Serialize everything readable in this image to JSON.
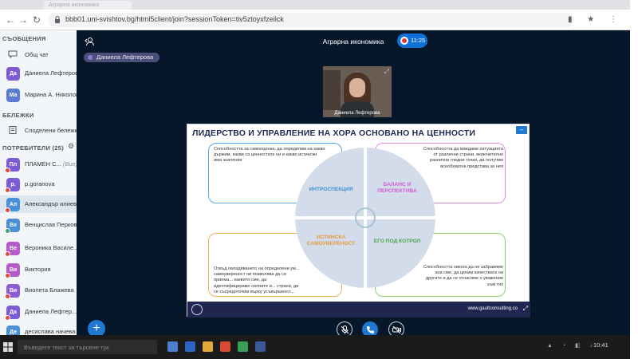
{
  "browser": {
    "tab_title": "Аграрна икономика",
    "url": "bbb01.uni-svishtov.bg/html5client/join?sessionToken=tiv5ztoyxfzeilck"
  },
  "sidebar": {
    "messages_title": "СЪОБЩЕНИЯ",
    "public_chat": "Общ чат",
    "private_chats": [
      {
        "initials": "Да",
        "name": "Даниела Лефтерова",
        "color": "#7b5cd6"
      },
      {
        "initials": "Ма",
        "name": "Марина А. Николова",
        "color": "#5a7bd1"
      }
    ],
    "notes_title": "БЕЛЕЖКИ",
    "shared_notes": "Споделени бележки",
    "users_title": "ПОТРЕБИТЕЛИ (25)",
    "users": [
      {
        "initials": "Пл",
        "name": "ПЛАМЕН С...",
        "suffix": "(Вие)",
        "color": "#7b5cd6",
        "status": "red"
      },
      {
        "initials": "p.",
        "name": "p.goranova",
        "suffix": "",
        "color": "#7b5cd6",
        "status": "red"
      },
      {
        "initials": "Ал",
        "name": "Александър илиев",
        "suffix": "",
        "color": "#4b8fd6",
        "status": "red"
      },
      {
        "initials": "Ве",
        "name": "Венцислав Перков",
        "suffix": "",
        "color": "#4b8fd6",
        "status": "green"
      },
      {
        "initials": "Ве",
        "name": "Вероника Василе...",
        "suffix": "",
        "color": "#b55bc9",
        "status": "red"
      },
      {
        "initials": "Ви",
        "name": "Виктория",
        "suffix": "",
        "color": "#b55bc9",
        "status": "red"
      },
      {
        "initials": "Ви",
        "name": "Виолета Блажева",
        "suffix": "",
        "color": "#8e5bd6",
        "status": "red"
      },
      {
        "initials": "Да",
        "name": "Даниела Лефтер...",
        "suffix": "",
        "color": "#7b5cd6",
        "status": "red"
      },
      {
        "initials": "Де",
        "name": "десислава начева",
        "suffix": "",
        "color": "#4b8fd6",
        "status": "red"
      }
    ]
  },
  "main": {
    "meeting_title": "Аграрна икономика",
    "recording_time": "11:25",
    "talking_indicator": "Даниела Лефтерова",
    "webcam_name": "Даниела Лефтерова"
  },
  "slide": {
    "title": "ЛИДЕРСТВО И УПРАВЛЕНИЕ НА ХОРА ОСНОВАНО НА ЦЕННОСТИ",
    "q1_text": "Способността за самооценка, да определим на какво държим, какви са ценностите ни и какво истински има значение",
    "q2_text": "Способността да виждаме ситуацията от различни страни, включително различни гледни точки, да получим всеобхватна представа за нея",
    "q3_text": "Отвъд овладяването на определени ум... самоувереност ни позволява да се приема... каквито сме, да идентифицираме силните и... страни, да се съсредоточим върху усъвършенст...",
    "q4_text": "Способността никога да не забравяме кои сме, да ценим качествата на другите и да се отнасяме с уважение към тях",
    "label_1": "ИНТРОСПЕКЦИЯ",
    "label_2": "БАЛАНС И ПЕРСПЕКТИВА",
    "label_3": "ИСТИНСКА САМОУВЕРЕНОСТ",
    "label_4": "ЕГО ПОД КОТРОЛ",
    "footer_url": "www.gaultconsulting.co"
  },
  "taskbar": {
    "search_placeholder": "Въведете текст за търсене тук",
    "clock": "10:41"
  },
  "colors": {
    "main_bg": "#06172a",
    "accent": "#1f78d1",
    "slide_title": "#1d2a52"
  }
}
